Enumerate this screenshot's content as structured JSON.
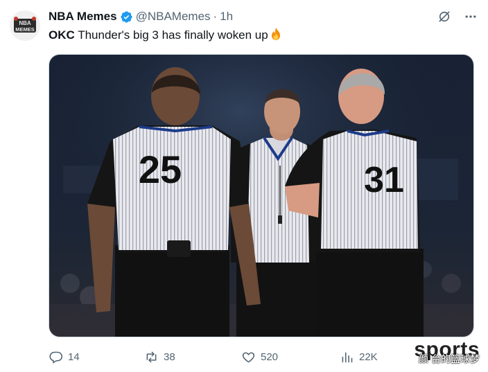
{
  "tweet": {
    "avatar_text_top": "NBA",
    "avatar_text_bottom": "MEMES",
    "display_name": "NBA Memes",
    "handle": "@NBAMemes",
    "separator": "·",
    "time": "1h",
    "text_bold": "OKC",
    "text_rest": " Thunder's big 3 has finally woken up",
    "emoji_icon": "fire-emoji"
  },
  "media": {
    "jersey_left": "25",
    "jersey_right": "31"
  },
  "actions": {
    "reply_count": "14",
    "retweet_count": "38",
    "like_count": "520",
    "view_count": "22K"
  },
  "watermark": {
    "big": "sports",
    "small": "颜  台的篮球梦"
  },
  "colors": {
    "verified": "#1d9bf0",
    "muted": "#536471",
    "text": "#0f1419"
  }
}
